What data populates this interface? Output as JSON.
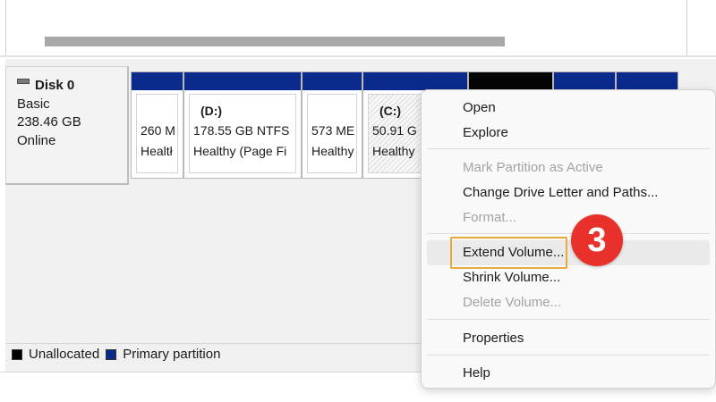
{
  "disk": {
    "name": "Disk 0",
    "type": "Basic",
    "size": "238.46 GB",
    "status": "Online"
  },
  "partitions": [
    {
      "name": "",
      "line1": "260 M",
      "line2": "Healtł",
      "bar": "#0a2a8c"
    },
    {
      "name": "(D:)",
      "line1": "178.55 GB NTFS",
      "line2": "Healthy (Page Fi",
      "bar": "#0a2a8c"
    },
    {
      "name": "",
      "line1": "573 ME",
      "line2": "Healthy",
      "bar": "#0a2a8c"
    },
    {
      "name": "(C:)",
      "line1": "50.91 G",
      "line2": "Healthy",
      "bar": "#0a2a8c"
    }
  ],
  "legend": {
    "unallocated": "Unallocated",
    "primary": "Primary partition",
    "unallocated_color": "#000000",
    "primary_color": "#0a2a8c"
  },
  "menu": {
    "open": "Open",
    "explore": "Explore",
    "mark_active": "Mark Partition as Active",
    "change_letter": "Change Drive Letter and Paths...",
    "format": "Format...",
    "extend": "Extend Volume...",
    "shrink": "Shrink Volume...",
    "delete": "Delete Volume...",
    "properties": "Properties",
    "help": "Help"
  },
  "annotation": {
    "step": "3",
    "badge_color": "#e8312a",
    "highlight_color": "#e6a93b"
  }
}
